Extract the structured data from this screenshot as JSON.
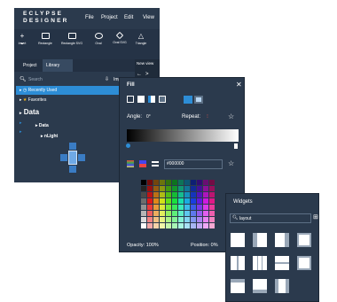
{
  "app": {
    "logo_line1": "ECLYPSE",
    "logo_line2": "DESIGNER",
    "menu": [
      "File",
      "Project",
      "Edit",
      "View"
    ]
  },
  "toolbar": {
    "tools": [
      "Insert",
      "Rectangle",
      "Rectangle SVG",
      "Oval",
      "Oval SVG",
      "Triangle"
    ]
  },
  "panel_tabs": {
    "project": "Project",
    "library": "Library"
  },
  "library": {
    "search_placeholder": "Search",
    "import_label": "Import",
    "recently_used": "Recently Used",
    "favorites": "Favorites",
    "section": "Data",
    "data_item": "Data",
    "nlight_item": "nLight"
  },
  "new_view": "New view",
  "fill_dialog": {
    "title": "Fill",
    "angle_label": "Angle:",
    "angle_value": "0°",
    "repeat_label": "Repeat:",
    "hex_value": "#000000",
    "opacity_label": "Opacity:",
    "opacity_value": "100%",
    "position_label": "Position:",
    "position_value": "0%"
  },
  "widgets_panel": {
    "title": "Widgets",
    "search_value": "layout"
  }
}
